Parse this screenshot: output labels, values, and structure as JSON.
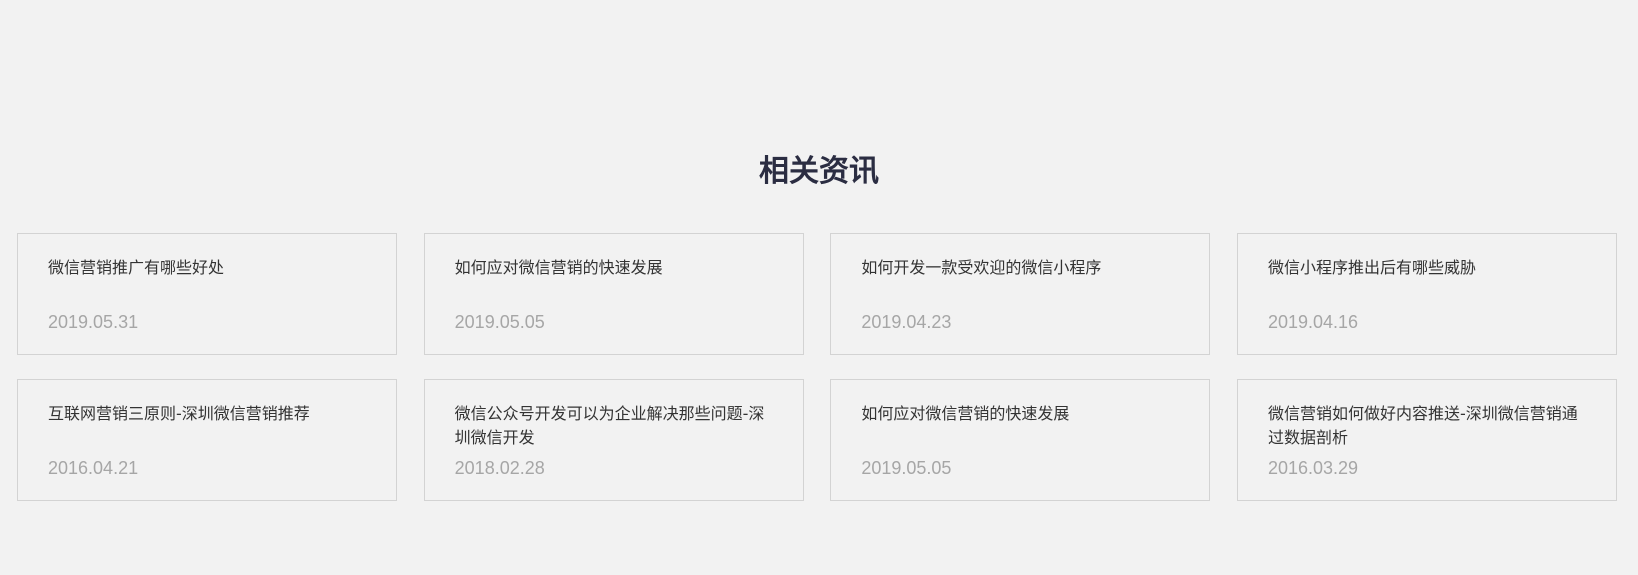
{
  "section": {
    "title": "相关资讯"
  },
  "news": [
    {
      "title": "微信营销推广有哪些好处",
      "date": "2019.05.31"
    },
    {
      "title": "如何应对微信营销的快速发展",
      "date": "2019.05.05"
    },
    {
      "title": "如何开发一款受欢迎的微信小程序",
      "date": "2019.04.23"
    },
    {
      "title": "微信小程序推出后有哪些威胁",
      "date": "2019.04.16"
    },
    {
      "title": "互联网营销三原则-深圳微信营销推荐",
      "date": "2016.04.21"
    },
    {
      "title": "微信公众号开发可以为企业解决那些问题-深圳微信开发",
      "date": "2018.02.28"
    },
    {
      "title": "如何应对微信营销的快速发展",
      "date": "2019.05.05"
    },
    {
      "title": "微信营销如何做好内容推送-深圳微信营销通过数据剖析",
      "date": "2016.03.29"
    }
  ]
}
